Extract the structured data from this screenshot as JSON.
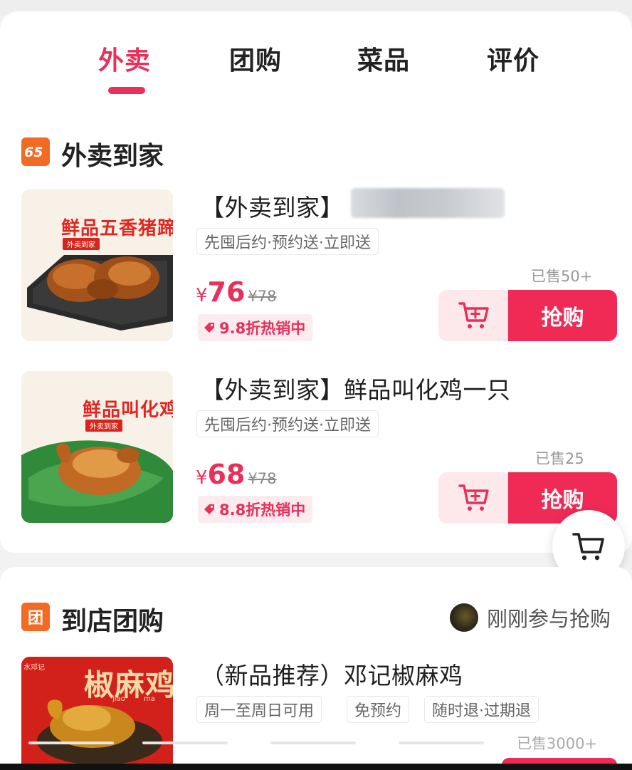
{
  "tabs": [
    {
      "label": "外卖",
      "active": true
    },
    {
      "label": "团购",
      "active": false
    },
    {
      "label": "菜品",
      "active": false
    },
    {
      "label": "评价",
      "active": false
    }
  ],
  "delivery_section": {
    "icon": "logo-65-icon",
    "title": "外卖到家",
    "products": [
      {
        "title": "【外卖到家】",
        "title_blurred": true,
        "thumb_caption": "鲜品五香猪蹄",
        "thumb_tag": "外卖到家",
        "badge": "先囤后约·预约送·立即送",
        "currency": "¥",
        "price": "76",
        "original_price": "¥78",
        "promo": "9.8折热销中",
        "sold": "已售50+",
        "buy_label": "抢购"
      },
      {
        "title": "【外卖到家】鲜品叫化鸡一只",
        "title_blurred": false,
        "thumb_caption": "鲜品叫化鸡",
        "thumb_tag": "外卖到家",
        "badge": "先囤后约·预约送·立即送",
        "currency": "¥",
        "price": "68",
        "original_price": "¥78",
        "promo": "8.8折热销中",
        "sold": "已售25",
        "buy_label": "抢购"
      }
    ]
  },
  "group_section": {
    "icon": "团",
    "title": "到店团购",
    "participants_text": "刚刚参与抢购",
    "product": {
      "title": "（新品推荐）邓记椒麻鸡",
      "thumb_caption": "椒麻鸡",
      "thumb_small": "水邓记",
      "thumb_pinyin_1": "jiao",
      "thumb_pinyin_2": "ma",
      "badges": [
        "周一至周日可用",
        "免预约",
        "随时退·过期退"
      ],
      "sold": "已售3000+"
    }
  },
  "colors": {
    "accent": "#e8305a",
    "buy_button": "#ef2a55",
    "section_icon": "#f36a25"
  }
}
